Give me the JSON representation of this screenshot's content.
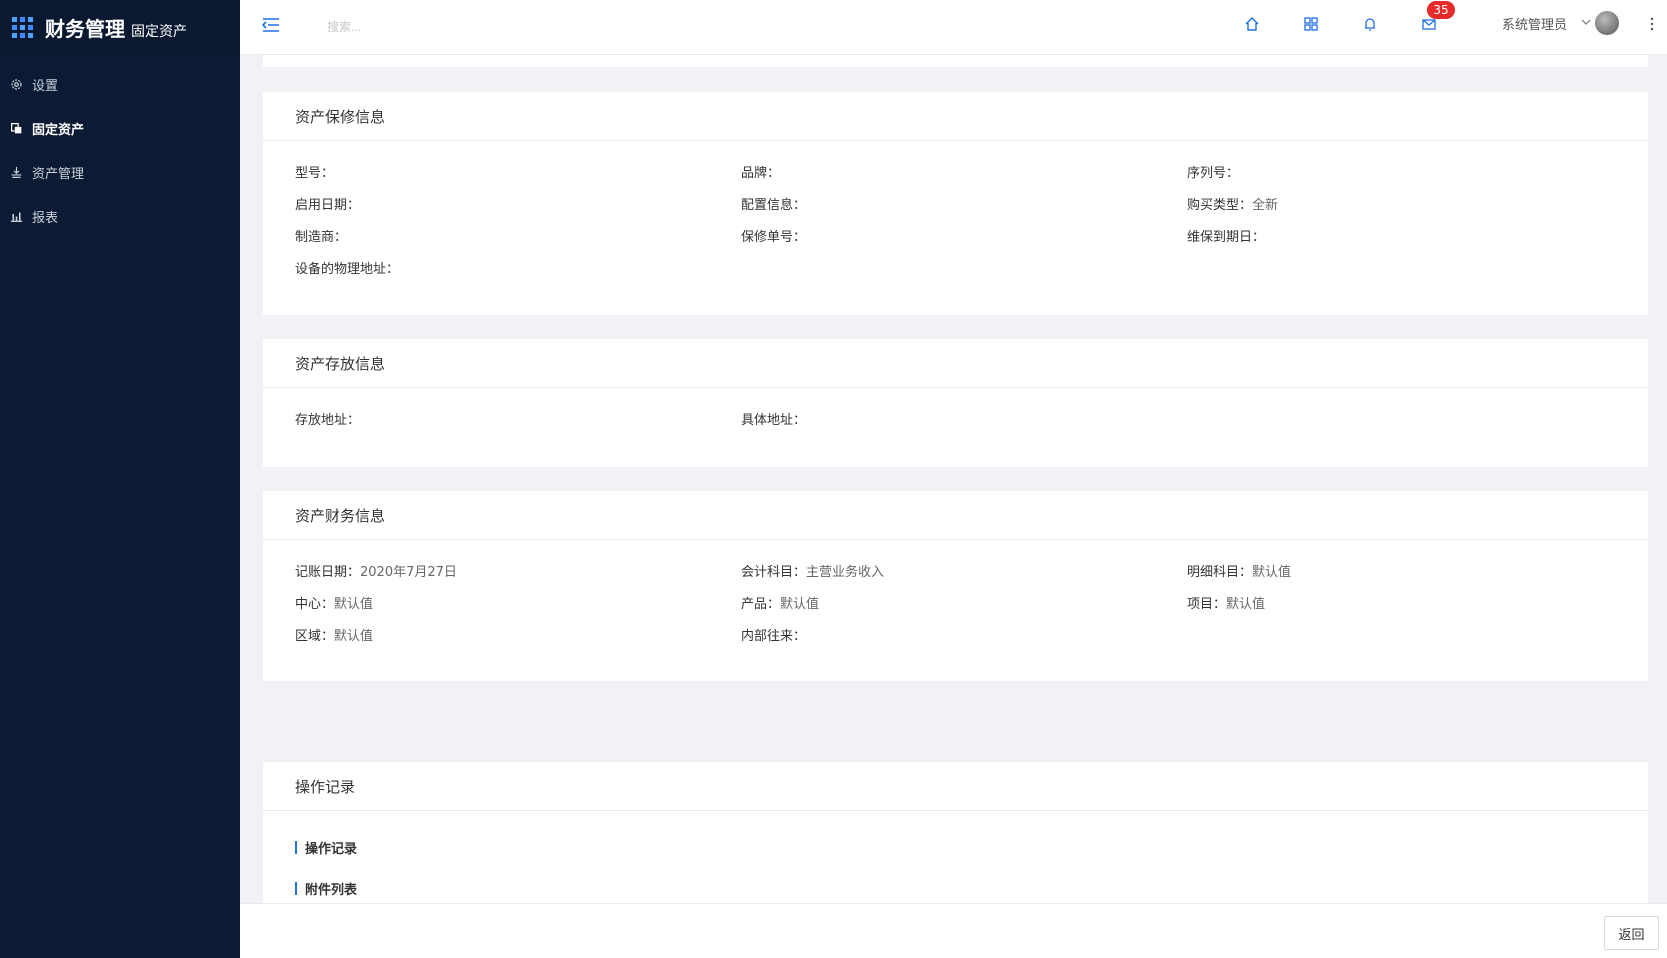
{
  "brand": {
    "title": "财务管理",
    "subtitle": "固定资产"
  },
  "sidebar": {
    "items": [
      {
        "label": "设置",
        "icon": "gear-icon"
      },
      {
        "label": "固定资产",
        "icon": "copy-icon",
        "active": true
      },
      {
        "label": "资产管理",
        "icon": "asset-icon"
      },
      {
        "label": "报表",
        "icon": "bar-chart-icon"
      }
    ]
  },
  "header": {
    "search_placeholder": "搜索...",
    "mail_badge": "35",
    "user_name": "系统管理员"
  },
  "warranty": {
    "title": "资产保修信息",
    "fields": [
      {
        "label": "型号：",
        "value": ""
      },
      {
        "label": "品牌：",
        "value": ""
      },
      {
        "label": "序列号：",
        "value": ""
      },
      {
        "label": "启用日期：",
        "value": ""
      },
      {
        "label": "配置信息：",
        "value": ""
      },
      {
        "label": "购买类型：",
        "value": "全新"
      },
      {
        "label": "制造商：",
        "value": ""
      },
      {
        "label": "保修单号：",
        "value": ""
      },
      {
        "label": "维保到期日：",
        "value": ""
      },
      {
        "label": "设备的物理地址：",
        "value": ""
      }
    ]
  },
  "storage": {
    "title": "资产存放信息",
    "fields": [
      {
        "label": "存放地址：",
        "value": ""
      },
      {
        "label": "具体地址：",
        "value": ""
      }
    ]
  },
  "finance": {
    "title": "资产财务信息",
    "fields": [
      {
        "label": "记账日期：",
        "value": "2020年7月27日"
      },
      {
        "label": "会计科目：",
        "value": "主营业务收入"
      },
      {
        "label": "明细科目：",
        "value": "默认值"
      },
      {
        "label": "中心：",
        "value": "默认值"
      },
      {
        "label": "产品：",
        "value": "默认值"
      },
      {
        "label": "项目：",
        "value": "默认值"
      },
      {
        "label": "区域：",
        "value": "默认值"
      },
      {
        "label": "内部往来：",
        "value": ""
      }
    ]
  },
  "records": {
    "title": "操作记录",
    "sub_operation": "操作记录",
    "sub_attachments": "附件列表"
  },
  "footer": {
    "back_label": "返回"
  },
  "colors": {
    "sidebar_bg": "#0c1b33",
    "accent": "#1e6fe0",
    "badge": "#e52b2b"
  }
}
